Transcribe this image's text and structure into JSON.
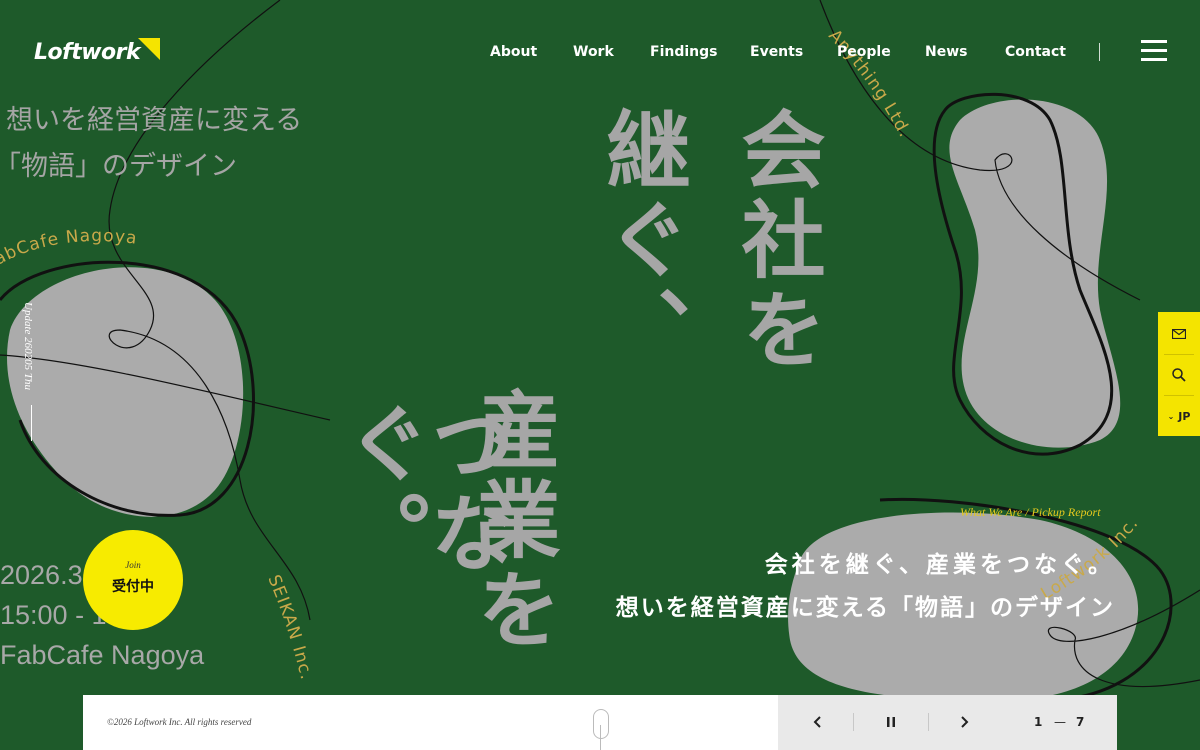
{
  "header": {
    "logo": "Loftwork",
    "nav": [
      "About",
      "Work",
      "Findings",
      "Events",
      "People",
      "News",
      "Contact"
    ]
  },
  "hero": {
    "subtitle_lines": [
      "想いを経営資産に変える",
      "「物語」のデザイン"
    ],
    "headline_right": "会社を",
    "headline_mid": "継ぐ、",
    "headline_left_a": "産業を",
    "headline_left_b": "つなぐ。",
    "event_date": "2026.3",
    "event_time": "15:00 - 17:00",
    "event_venue": "FabCafe Nagoya",
    "update_label": "Update 260205 Thu",
    "curved_texts": [
      "FabCafe Nagoya",
      "Anything Ltd.",
      "Loftwork Inc.",
      "SEIKAN Inc."
    ]
  },
  "join": {
    "small": "Join",
    "main": "受付中"
  },
  "caption": {
    "label": "What We Are / Pickup Report",
    "line1": "会社を継ぐ、産業をつなぐ。",
    "line2": "想いを経営資産に変える「物語」のデザイン"
  },
  "side": {
    "lang": "JP"
  },
  "footer": {
    "copyright": "©2026 Loftwork Inc. All rights reserved",
    "page_current": "1",
    "page_dash": "—",
    "page_total": "7"
  },
  "icons": [
    "mail-icon",
    "search-icon",
    "chevron-down-icon",
    "chevron-left-icon",
    "pause-icon",
    "chevron-right-icon",
    "menu-icon",
    "mouse-scroll-icon"
  ],
  "colors": {
    "background": "#1e5a2a",
    "accent": "#f5e400",
    "gray_text": "#a6a6a6",
    "gold_text": "#c9a94a"
  }
}
